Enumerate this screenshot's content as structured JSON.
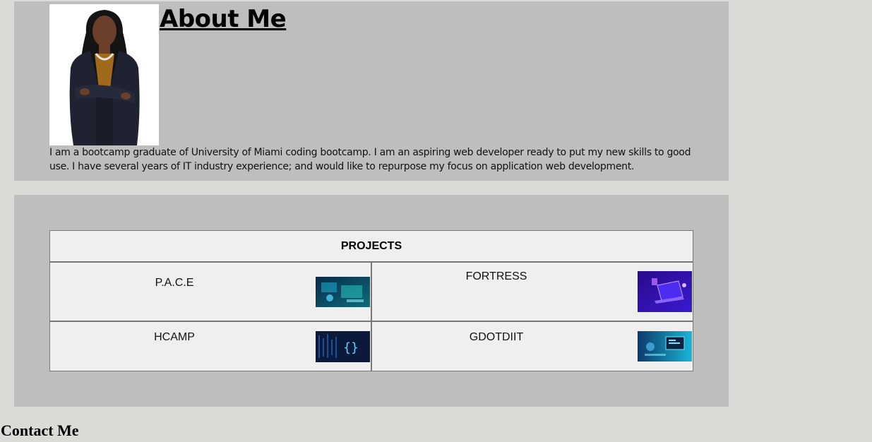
{
  "about": {
    "title": "About Me",
    "bio": "I am a bootcamp graduate of University of Miami coding bootcamp. I am an aspiring web developer ready to put my new skills to good use. I have several years of IT industry experience; and would like to repurpose my focus on application web development."
  },
  "projects": {
    "header": "PROJECTS",
    "items": [
      {
        "name": "P.A.C.E"
      },
      {
        "name": "FORTRESS"
      },
      {
        "name": "HCAMP"
      },
      {
        "name": "GDOTDIIT"
      }
    ]
  },
  "contact": {
    "title": "Contact Me"
  },
  "colors": {
    "page_bg": "#d9dbd6",
    "section_bg": "#bebebe",
    "card_bg": "#efefef"
  }
}
